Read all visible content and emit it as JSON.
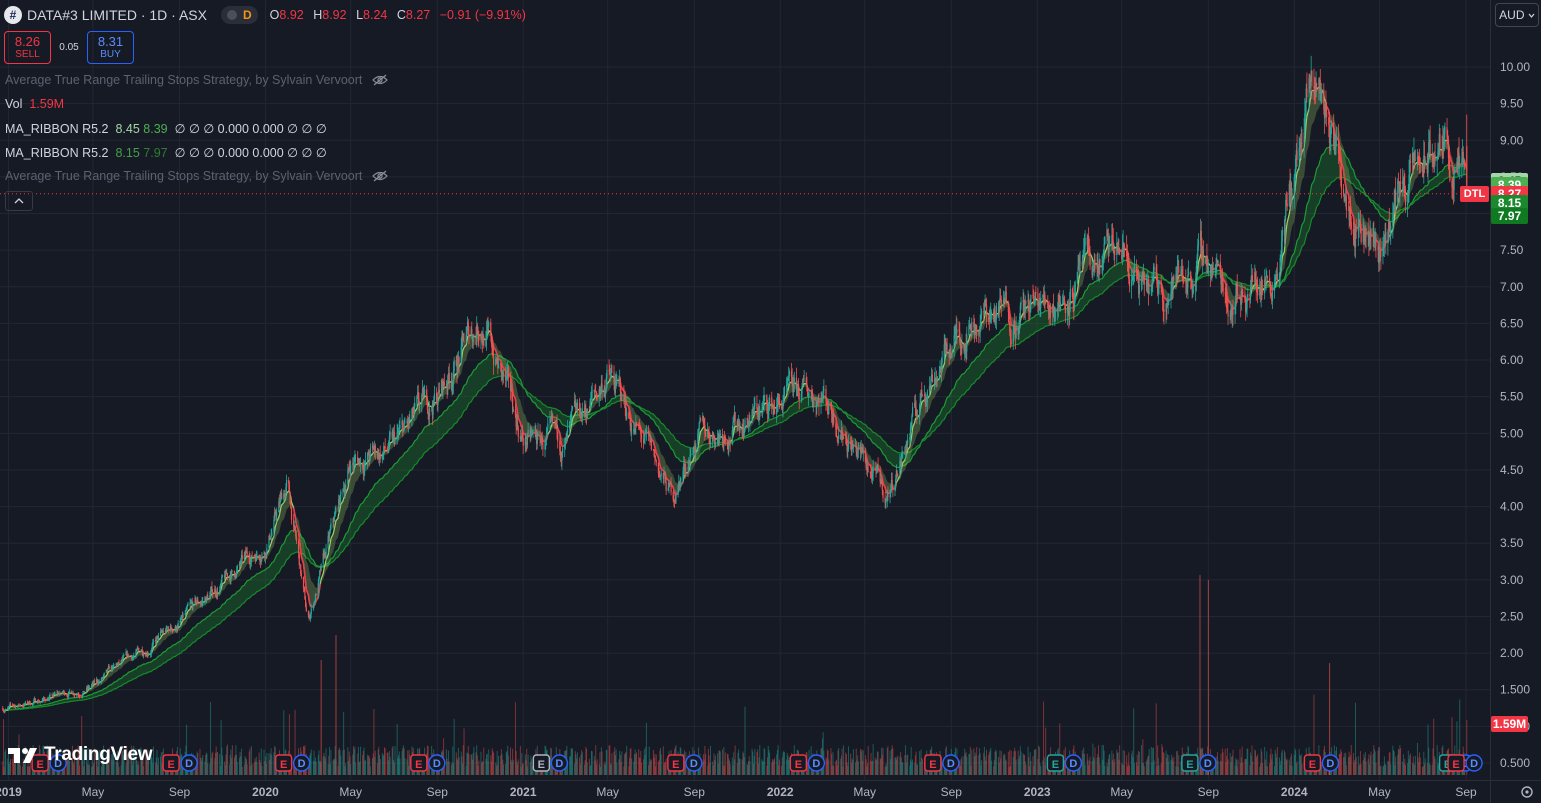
{
  "header": {
    "symbol_icon": "#",
    "title": "DATA#3 LIMITED · 1D · ASX",
    "d_badge": "D",
    "open_label": "O",
    "open": "8.92",
    "high_label": "H",
    "high": "8.92",
    "low_label": "L",
    "low": "8.24",
    "close_label": "C",
    "close": "8.27",
    "change": "−0.91 (−9.91%)"
  },
  "trade": {
    "sell_price": "8.26",
    "sell_label": "SELL",
    "spread": "0.05",
    "buy_price": "8.31",
    "buy_label": "BUY"
  },
  "indicators": {
    "atr1": "Average True Range Trailing Stops Strategy, by Sylvain Vervoort",
    "vol_label": "Vol",
    "vol_value": "1.59M",
    "ribbon1_name": "MA_RIBBON R5.2",
    "ribbon1_v1": "8.45",
    "ribbon1_v2": "8.39",
    "ribbon1_rest": "∅ ∅ ∅ 0.000 0.000 ∅ ∅ ∅",
    "ribbon2_name": "MA_RIBBON R5.2",
    "ribbon2_v1": "8.15",
    "ribbon2_v2": "7.97",
    "ribbon2_rest": "∅ ∅ ∅ 0.000 0.000 ∅ ∅ ∅",
    "atr2": "Average True Range Trailing Stops Strategy, by Sylvain Vervoort"
  },
  "currency": "AUD",
  "logo_text": "TradingView",
  "price_labels": {
    "p1": "8.45",
    "p2": "8.39",
    "last": "8.27",
    "p3": "8.15",
    "p4": "7.97",
    "vol": "1.59M",
    "ticker": "DTL"
  },
  "colors": {
    "bg": "#161a25",
    "up": "#26a69a",
    "down": "#ef5350",
    "ribbon_fast": "#9ccc65",
    "ribbon_slow": "#1b8a2e",
    "last_price": "#f23645"
  },
  "earnings_letter": "E",
  "dividend_letter": "D",
  "chart_data": {
    "type": "candlestick",
    "ylim": [
      0.5,
      10.2
    ],
    "yticks": [
      "10.00",
      "9.50",
      "9.00",
      "8.50",
      "8.00",
      "7.50",
      "7.00",
      "6.50",
      "6.00",
      "5.50",
      "5.00",
      "4.50",
      "4.00",
      "3.50",
      "3.00",
      "2.50",
      "2.00",
      "1.500",
      "1.000",
      "0.500"
    ],
    "xticks": [
      "2019",
      "May",
      "Sep",
      "2020",
      "May",
      "Sep",
      "2021",
      "May",
      "Sep",
      "2022",
      "May",
      "Sep",
      "2023",
      "May",
      "Sep",
      "2024",
      "May",
      "Sep"
    ],
    "approx_close_path": {
      "dates": [
        "2019-01",
        "2019-05",
        "2019-09",
        "2020-01",
        "2020-02",
        "2020-03",
        "2020-05",
        "2020-07",
        "2020-09",
        "2020-11",
        "2021-01",
        "2021-03",
        "2021-05",
        "2021-08",
        "2021-09",
        "2021-12",
        "2022-03",
        "2022-06",
        "2022-08",
        "2022-10",
        "2023-01",
        "2023-05",
        "2023-06",
        "2023-09",
        "2023-10",
        "2023-12",
        "2024-02",
        "2024-03",
        "2024-05",
        "2024-06",
        "2024-08",
        "2024-09"
      ],
      "values": [
        1.25,
        1.55,
        2.4,
        3.5,
        4.3,
        2.4,
        4.6,
        4.8,
        5.5,
        6.6,
        4.9,
        4.8,
        5.8,
        4.1,
        4.9,
        5.3,
        5.6,
        4.1,
        5.8,
        6.6,
        6.7,
        7.5,
        6.8,
        7.4,
        6.9,
        7.2,
        9.8,
        8.8,
        7.5,
        8.4,
        8.9,
        8.27
      ]
    }
  }
}
